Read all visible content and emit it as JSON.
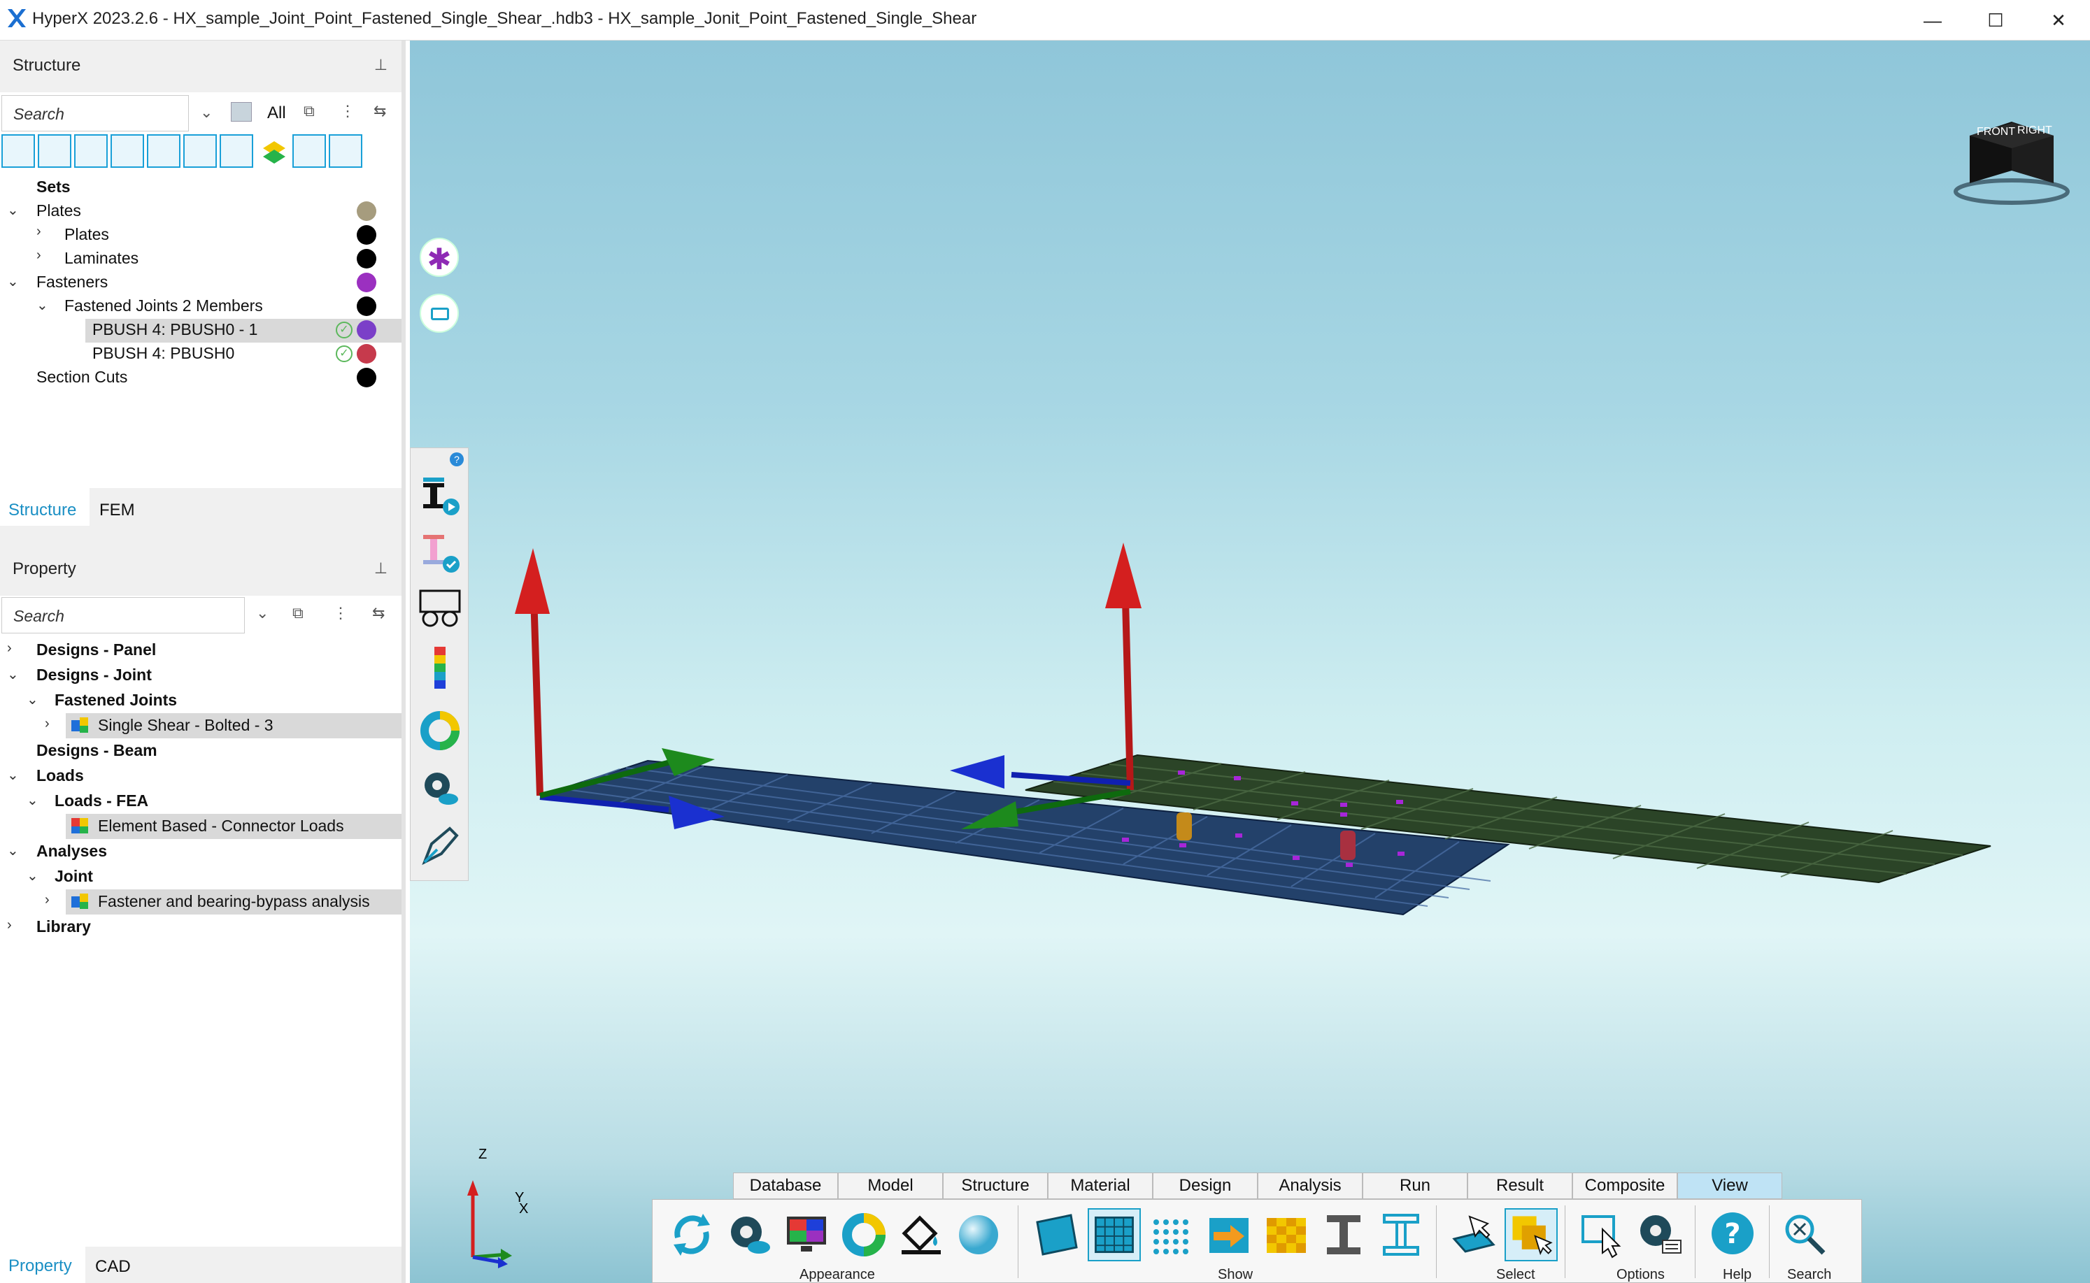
{
  "window": {
    "title": "HyperX 2023.2.6 - HX_sample_Joint_Point_Fastened_Single_Shear_.hdb3 - HX_sample_Jonit_Point_Fastened_Single_Shear",
    "minimize": "—",
    "maximize": "☐",
    "close": "✕"
  },
  "structure_panel": {
    "title": "Structure",
    "pin": "⊥",
    "search_placeholder": "Search",
    "filter_all": "All",
    "tree": {
      "sets": "Sets",
      "plates_group": "Plates",
      "plates": "Plates",
      "laminates": "Laminates",
      "fasteners": "Fasteners",
      "fastened_joints": "Fastened Joints 2 Members",
      "pbush1": "PBUSH 4: PBUSH0 - 1",
      "pbush0": "PBUSH 4: PBUSH0",
      "section_cuts": "Section Cuts"
    },
    "colors": {
      "plates_group": "#a69c7e",
      "plates": "#000000",
      "laminates": "#000000",
      "fasteners": "#9b30c0",
      "fastened_joints": "#000000",
      "pbush1": "#7b3fc8",
      "pbush0": "#c63a4c",
      "section_cuts": "#000000"
    },
    "tabs": {
      "structure": "Structure",
      "fem": "FEM"
    }
  },
  "property_panel": {
    "title": "Property",
    "pin": "⊥",
    "search_placeholder": "Search",
    "tree": {
      "designs_panel": "Designs - Panel",
      "designs_joint": "Designs - Joint",
      "fastened_joints": "Fastened Joints",
      "single_shear": "Single Shear - Bolted - 3",
      "designs_beam": "Designs - Beam",
      "loads": "Loads",
      "loads_fea": "Loads - FEA",
      "element_based": "Element Based - Connector Loads",
      "analyses": "Analyses",
      "joint": "Joint",
      "fastener_analysis": "Fastener and bearing-bypass analysis",
      "library": "Library"
    },
    "tabs": {
      "property": "Property",
      "cad": "CAD"
    }
  },
  "viewcube": {
    "front": "FRONT",
    "right": "RIGHT"
  },
  "axes": {
    "z": "Z",
    "y": "Y",
    "x": "X"
  },
  "side_toolbar": {
    "help": "?"
  },
  "ribbon": {
    "tabs": [
      "Database",
      "Model",
      "Structure",
      "Material",
      "Design",
      "Analysis",
      "Run",
      "Result",
      "Composite",
      "View"
    ],
    "active_tab": "View",
    "groups": {
      "appearance": "Appearance",
      "show": "Show",
      "select": "Select",
      "options": "Options",
      "help": "Help",
      "search": "Search"
    }
  }
}
